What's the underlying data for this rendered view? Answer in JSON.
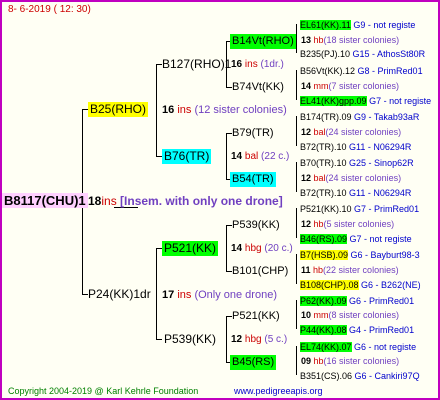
{
  "header": {
    "date": "8-  6-2019 ( 12: 30)"
  },
  "footer": {
    "copyright": "Copyright 2004-2019 @ Karl Kehrle Foundation",
    "url": "www.pedigreeapis.org"
  },
  "root": {
    "label": "B8117(CHU)1",
    "num": "18",
    "ins": "ins",
    "note": "[Insem. with only one drone]"
  },
  "gen1": [
    {
      "label": "B25(RHO)",
      "num": "16",
      "ins": "ins",
      "note": "(12 sister colonies)"
    },
    {
      "label": "P24(KK)1dr",
      "num": "17",
      "ins": "ins",
      "note": "(Only one drone)"
    }
  ],
  "gen2": [
    {
      "label": "B127(RHO)1",
      "num": "16",
      "ins": "ins",
      "note": "(1dr.)"
    },
    {
      "label": "B76(TR)",
      "num": "14",
      "ins": "bal",
      "note": "(22 c.)"
    },
    {
      "label": "P521(KK)",
      "num": "14",
      "ins": "hbg",
      "note": "(20 c.)"
    },
    {
      "label": "P539(KK)",
      "num": "12",
      "ins": "hbg",
      "note": "(5 c.)"
    }
  ],
  "gen3": [
    {
      "label": "B14Vt(RHO)",
      "num": "13",
      "ins": "hb",
      "note": "(18 sister colonies)"
    },
    {
      "label": "B74Vt(KK)",
      "num": "14",
      "ins": "mm",
      "note": "(7 sister colonies)"
    },
    {
      "label": "B79(TR)",
      "num": "12",
      "ins": "bal",
      "note": "(24 sister colonies)"
    },
    {
      "label": "B54(TR)",
      "num": "12",
      "ins": "bal",
      "note": "(24 sister colonies)"
    },
    {
      "label": "P539(KK)",
      "num": "12",
      "ins": "hb",
      "note": "(5 sister colonies)"
    },
    {
      "label": "B101(CHP)",
      "num": "11",
      "ins": "hb",
      "note": "(22 sister colonies)"
    },
    {
      "label": "P521(KK)",
      "num": "10",
      "ins": "mm",
      "note": "(8 sister colonies)"
    },
    {
      "label": "B45(RS)",
      "num": "09",
      "ins": "hb",
      "note": "(16 sister colonies)"
    }
  ],
  "gen4": [
    {
      "label": "EL61(KK).11",
      "code": "G9 - not registe"
    },
    {
      "label": "B235(PJ).10",
      "code": "G15 - AthosSt80R"
    },
    {
      "label": "B56Vt(KK).12",
      "code": "G8 - PrimRed01"
    },
    {
      "label": "EL41(KK)gpp.09",
      "code": "G7 - not registe"
    },
    {
      "label": "B174(TR).09",
      "code": "G9 - Takab93aR"
    },
    {
      "label": "B72(TR).10",
      "code": "G11 - N06294R"
    },
    {
      "label": "B70(TR).10",
      "code": "G25 - Sinop62R"
    },
    {
      "label": "B72(TR).10",
      "code": "G11 - N06294R"
    },
    {
      "label": "P521(KK).10",
      "code": "G7 - PrimRed01"
    },
    {
      "label": "B46(RS).09",
      "code": "G7 - not registe"
    },
    {
      "label": "B7(HSB).09",
      "code": "G6 - Bayburt98-3"
    },
    {
      "label": "B108(CHP).08",
      "code": "G6 - B262(NE)"
    },
    {
      "label": "P62(KK).09",
      "code": "G6 - PrimRed01"
    },
    {
      "label": "P44(KK).08",
      "code": "G4 - PrimRed01"
    },
    {
      "label": "EL74(KK).07",
      "code": "G6 - not registe"
    },
    {
      "label": "B351(CS).06",
      "code": "G6 - Cankiri97Q"
    }
  ]
}
